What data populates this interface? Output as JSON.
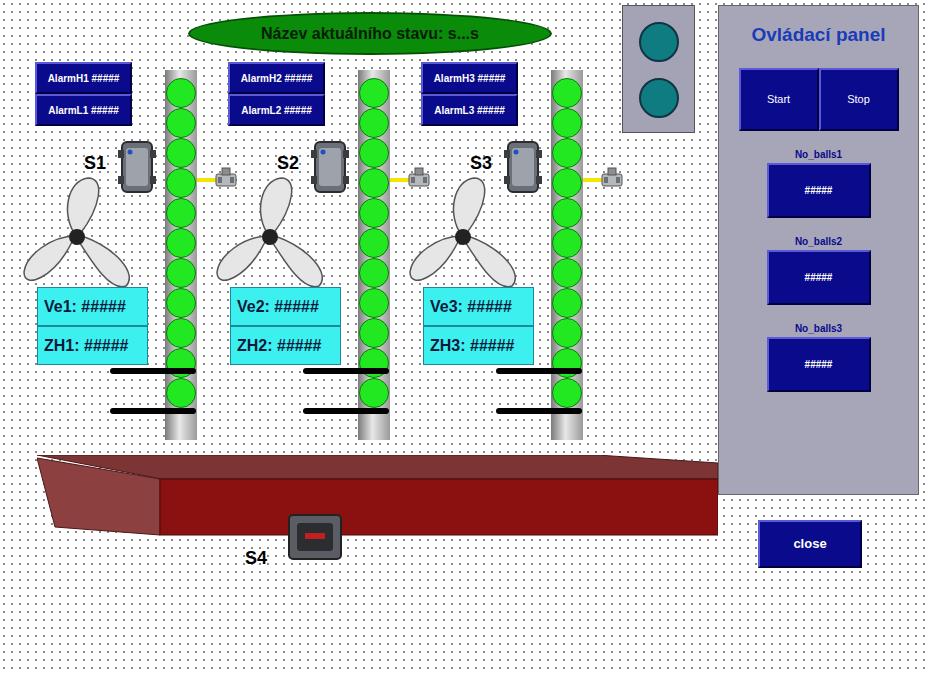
{
  "status": {
    "label": "Název aktuálního stavu: s...s"
  },
  "lights": [
    {
      "on": false
    },
    {
      "on": false
    }
  ],
  "lines": [
    {
      "sensor": "S1",
      "alarm_high": "AlarmH1 #####",
      "alarm_low": "AlarmL1 #####",
      "velocity": "Ve1: #####",
      "zh": "ZH1: #####",
      "balls": 11
    },
    {
      "sensor": "S2",
      "alarm_high": "AlarmH2 #####",
      "alarm_low": "AlarmL2 #####",
      "velocity": "Ve2: #####",
      "zh": "ZH2: #####",
      "balls": 11
    },
    {
      "sensor": "S3",
      "alarm_high": "AlarmH3 #####",
      "alarm_low": "AlarmL3 #####",
      "velocity": "Ve3: #####",
      "zh": "ZH3: #####",
      "balls": 11
    }
  ],
  "box": {
    "sensor": "S4"
  },
  "panel": {
    "title": "Ovládací panel",
    "buttons": [
      "Start",
      "Stop"
    ],
    "counters": [
      {
        "label": "No_balls1",
        "value": "#####"
      },
      {
        "label": "No_balls2",
        "value": "#####"
      },
      {
        "label": "No_balls3",
        "value": "#####"
      }
    ]
  },
  "close": "close"
}
